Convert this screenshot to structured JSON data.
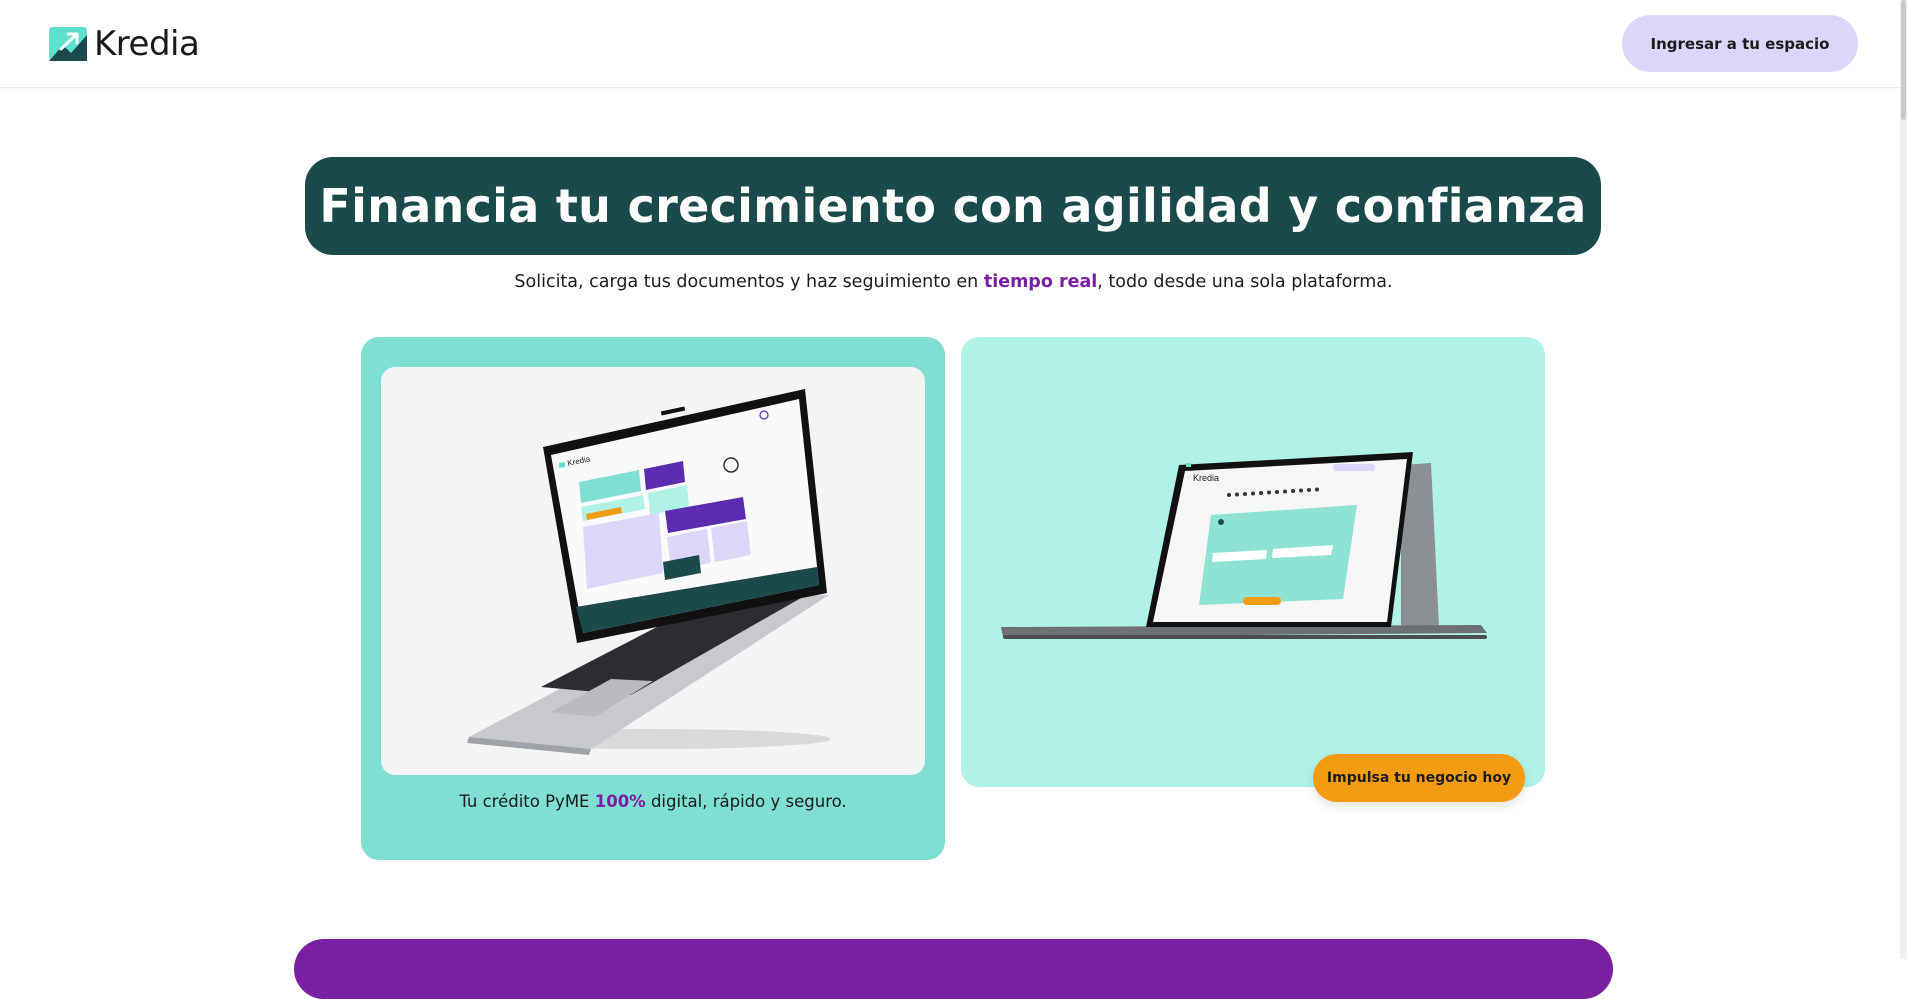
{
  "header": {
    "brand": "Kredia",
    "login_label": "Ingresar a tu espacio"
  },
  "hero": {
    "title": "Financia tu crecimiento con agilidad y confianza",
    "subtitle_before": "Solicita, carga tus documentos y haz seguimiento en ",
    "subtitle_highlight": "tiempo real",
    "subtitle_after": ", todo desde una sola plataforma."
  },
  "card_left": {
    "caption_before": "Tu crédito PyME ",
    "caption_highlight": "100%",
    "caption_after": " digital, rápido y seguro.",
    "screen_brand": "Kredia"
  },
  "card_right": {
    "screen_brand": "Kredia",
    "cta_label": "Impulsa tu negocio hoy"
  },
  "colors": {
    "hero_bg": "#1b4a4c",
    "accent_purple": "#7a1fa2",
    "login_bg": "#dcd6fb",
    "card_left_bg": "#7fdfd2",
    "card_right_bg": "#b1f2e8",
    "cta_bg": "#f39c12"
  },
  "icons": [
    "kredia-logo-icon",
    "laptop-dashboard-image",
    "laptop-form-image"
  ]
}
